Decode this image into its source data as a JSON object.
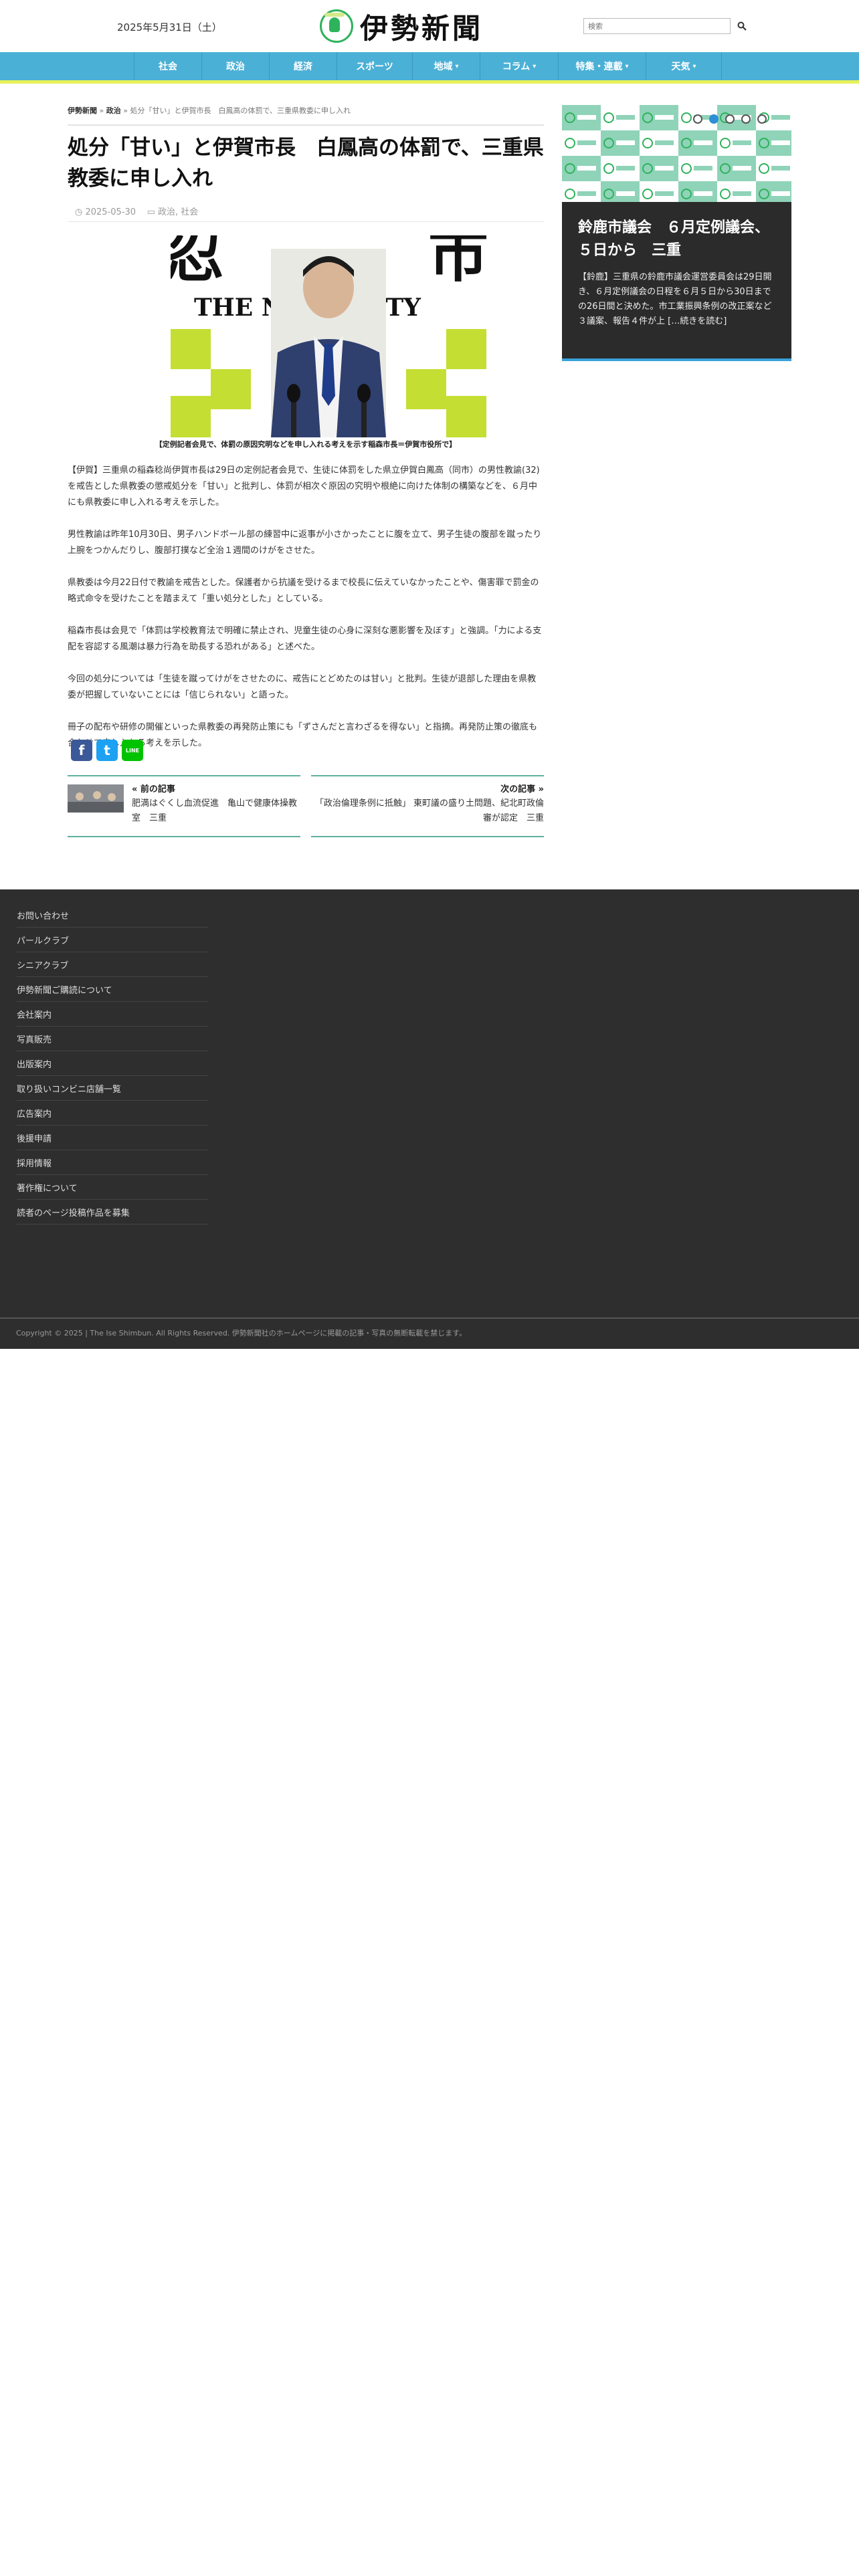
{
  "header": {
    "date": "2025年5月31日（土）",
    "logo_text": "伊勢新聞",
    "logo_badge_text": "伊勢新聞",
    "search_placeholder": "検索",
    "search_icon": "search-icon"
  },
  "nav": {
    "items": [
      {
        "label": "社会",
        "dropdown": false
      },
      {
        "label": "政治",
        "dropdown": false
      },
      {
        "label": "経済",
        "dropdown": false
      },
      {
        "label": "スポーツ",
        "dropdown": false
      },
      {
        "label": "地域",
        "dropdown": true
      },
      {
        "label": "コラム",
        "dropdown": true
      },
      {
        "label": "特集・連載",
        "dropdown": true
      },
      {
        "label": "天気",
        "dropdown": true
      }
    ],
    "bar_color": "#4bb0d6",
    "accent_color": "#e6f15b"
  },
  "breadcrumb": {
    "home": "伊勢新聞",
    "sep": "»",
    "category": "政治",
    "current": "処分「甘い」と伊賀市長　白鳳高の体罰で、三重県教委に申し入れ"
  },
  "article": {
    "title": "処分「甘い」と伊賀市長　白鳳高の体罰で、三重県教委に申し入れ",
    "date": "2025-05-30",
    "categories": "政治, 社会",
    "photo_sign_text": "THE NINJA CITY",
    "caption": "【定例記者会見で、体罰の原因究明などを申し入れる考えを示す稲森市長＝伊賀市役所で】",
    "paragraphs": [
      "【伊賀】三重県の稲森稔尚伊賀市長は29日の定例記者会見で、生徒に体罰をした県立伊賀白鳳高（同市）の男性教諭(32)を戒告とした県教委の懲戒処分を「甘い」と批判し、体罰が相次ぐ原因の究明や根絶に向けた体制の構築などを、６月中にも県教委に申し入れる考えを示した。",
      "男性教諭は昨年10月30日、男子ハンドボール部の練習中に返事が小さかったことに腹を立て、男子生徒の腹部を蹴ったり上腕をつかんだりし、腹部打撲など全治１週間のけがをさせた。",
      "県教委は今月22日付で教諭を戒告とした。保護者から抗議を受けるまで校長に伝えていなかったことや、傷害罪で罰金の略式命令を受けたことを踏まえて「重い処分とした」としている。",
      "稲森市長は会見で「体罰は学校教育法で明確に禁止され、児童生徒の心身に深刻な悪影響を及ぼす」と強調。「力による支配を容認する風潮は暴力行為を助長する恐れがある」と述べた。",
      "今回の処分については「生徒を蹴ってけがをさせたのに、戒告にとどめたのは甘い」と批判。生徒が退部した理由を県教委が把握していないことには「信じられない」と語った。",
      "冊子の配布や研修の開催といった県教委の再発防止策にも「ずさんだと言わざるを得ない」と指摘。再発防止策の徹底も合わせて申し入れる考えを示した。"
    ]
  },
  "share": {
    "facebook": "f",
    "twitter": "t",
    "line": "LINE"
  },
  "post_nav": {
    "prev_label": "« 前の記事",
    "prev_title": "肥満はぐくし血流促進　亀山で健康体操教室　三重",
    "next_label": "次の記事 »",
    "next_title": "「政治倫理条例に抵触」 東町議の盛り土問題、紀北町政倫審が認定　三重"
  },
  "sidebar": {
    "slide_title": "鈴鹿市議会　６月定例議会、５日から　三重",
    "slide_excerpt": "【鈴鹿】三重県の鈴鹿市議会運営委員会は29日開き、６月定例議会の日程を６月５日から30日までの26日間と決めた。市工業振興条例の改正案など３議案、報告４件が上 […続きを読む]",
    "dots": [
      false,
      true,
      false,
      false,
      false
    ]
  },
  "footer": {
    "links": [
      "お問い合わせ",
      "パールクラブ",
      "シニアクラブ",
      "伊勢新聞ご購読について",
      "会社案内",
      "写真販売",
      "出版案内",
      "取り扱いコンビニ店舗一覧",
      "広告案内",
      "後援申請",
      "採用情報",
      "著作権について",
      "読者のページ投稿作品を募集"
    ],
    "copyright": "Copyright © 2025 | The Ise Shimbun. All Rights Reserved. 伊勢新聞社のホームページに掲載の記事・写真の無断転載を禁じます。"
  }
}
